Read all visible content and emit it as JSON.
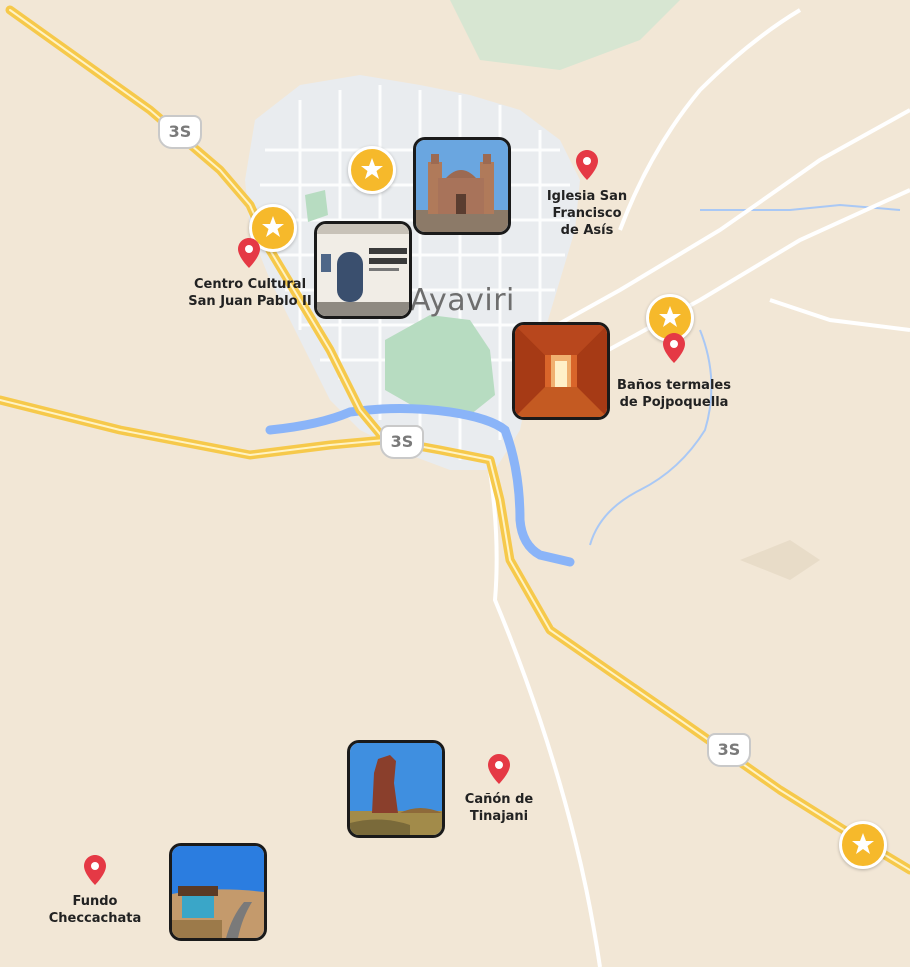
{
  "map": {
    "city_name": "Ayaviri",
    "route_shield": "3S",
    "colors": {
      "land": "#f2e7d6",
      "town": "#e9ecef",
      "park": "#b7dcc1",
      "river": "#8ab4f8",
      "highway": "#f6c94b",
      "pin": "#e53945",
      "star_marker": "#f6b92b"
    }
  },
  "places": [
    {
      "id": "iglesia",
      "name_line1": "Iglesia San Francisco",
      "name_line2": "de Asís",
      "icon": "church-photo"
    },
    {
      "id": "centro",
      "name_line1": "Centro Cultural",
      "name_line2": "San Juan Pablo II",
      "icon": "building-photo"
    },
    {
      "id": "banos",
      "name_line1": "Baños termales",
      "name_line2": "de Pojpoquella",
      "icon": "tunnel-photo"
    },
    {
      "id": "canon",
      "name_line1": "Cañón de",
      "name_line2": "Tinajani",
      "icon": "rock-photo"
    },
    {
      "id": "fundo",
      "name_line1": "Fundo",
      "name_line2": "Checcachata",
      "icon": "farm-photo"
    }
  ],
  "star_markers": [
    "star-icon",
    "star-icon",
    "star-icon",
    "star-icon"
  ]
}
